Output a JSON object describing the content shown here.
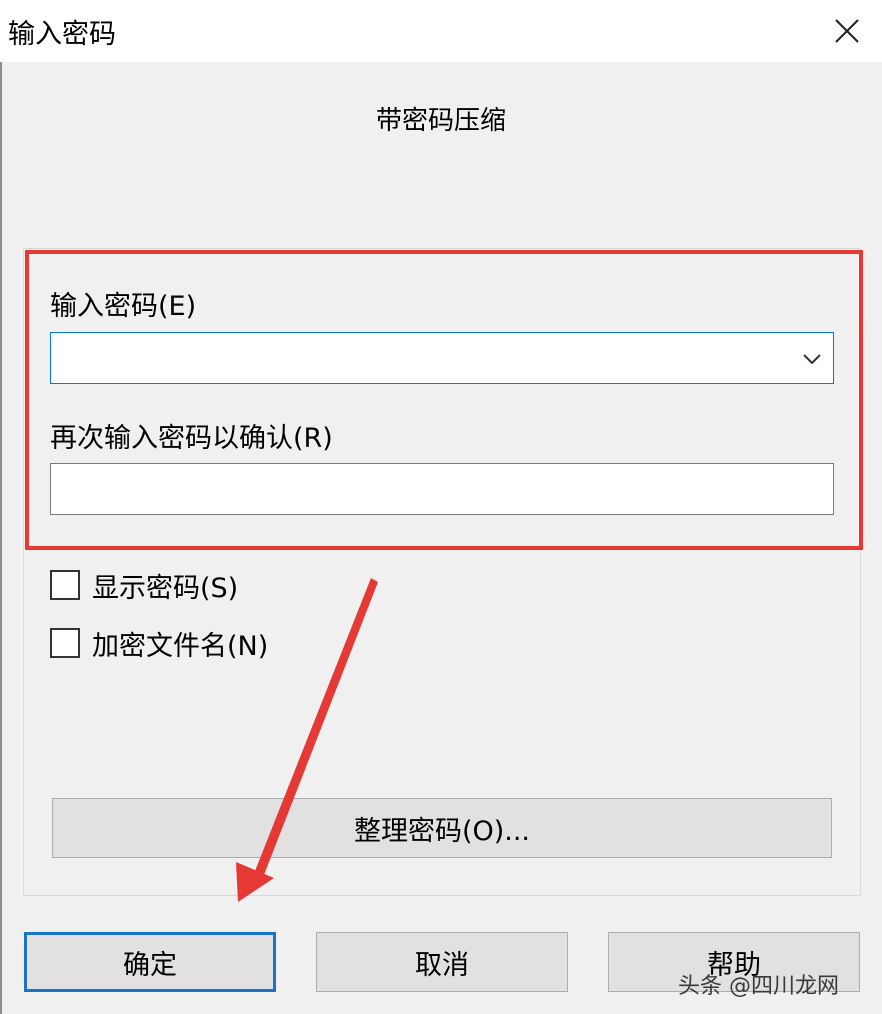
{
  "window": {
    "title": "输入密码",
    "close_icon": "close-icon"
  },
  "dialog": {
    "heading": "带密码压缩",
    "password_label": "输入密码(E)",
    "password_value": "",
    "confirm_label": "再次输入密码以确认(R)",
    "confirm_value": "",
    "show_password_label": "显示密码(S)",
    "show_password_checked": false,
    "encrypt_names_label": "加密文件名(N)",
    "encrypt_names_checked": false,
    "organize_button": "整理密码(O)..."
  },
  "buttons": {
    "ok": "确定",
    "cancel": "取消",
    "help": "帮助"
  },
  "annotations": {
    "highlight_color": "#e53935",
    "arrow_color": "#e53935"
  },
  "watermark": "头条 @四川龙网"
}
